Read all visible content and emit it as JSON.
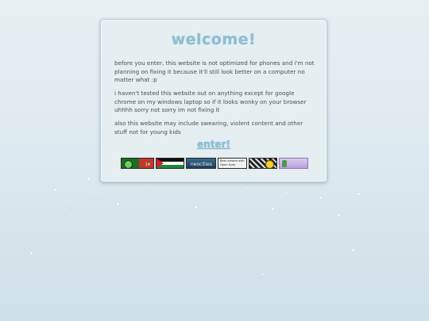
{
  "welcome": {
    "title": "welcome!",
    "paragraphs": [
      "before you enter, this website is not optimized for phones and i'm not planning on fixing it because it'll still look better on a computer no matter what :p",
      "i haven't tested this website out on anything except for google chrome on my windows laptop so if it looks wonky on your browser uhhhh sorry not sorry im not fixing it",
      "also this website may include swearing, violent content and other stuff not for young kids"
    ],
    "enter_label": "enter!"
  },
  "badges": [
    {
      "name": "frog-badge",
      "text": "14"
    },
    {
      "name": "palestine-flag-badge",
      "text": ""
    },
    {
      "name": "neocities-badge",
      "text": "neocities"
    },
    {
      "name": "opera-badge",
      "text": "Best viewed with Open Eyes"
    },
    {
      "name": "smiley-badge",
      "text": ""
    },
    {
      "name": "purple-badge",
      "text": ""
    }
  ],
  "colors": {
    "accent": "#8fc0d6",
    "text": "#4a4f55",
    "card_bg": "#e5eef1",
    "page_bg": "#dbe8ed"
  }
}
